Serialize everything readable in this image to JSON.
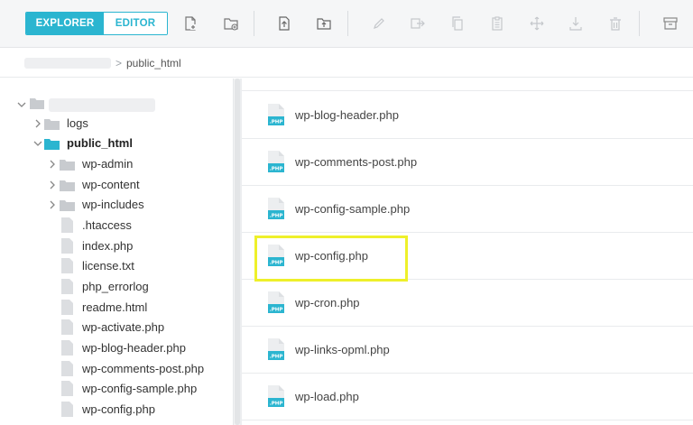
{
  "toolbar": {
    "explorer_label": "EXPLORER",
    "editor_label": "EDITOR",
    "accent_color": "#2bb5d0",
    "icons": [
      "new-file-icon",
      "new-folder-icon",
      "upload-file-icon",
      "upload-folder-icon",
      "rename-icon",
      "move-icon",
      "copy-icon",
      "paste-icon",
      "drag-move-icon",
      "download-icon",
      "delete-icon",
      "archive-icon"
    ]
  },
  "breadcrumb": {
    "separator": ">",
    "current": "public_html"
  },
  "tree": {
    "items": [
      {
        "label": "logs"
      },
      {
        "label": "public_html"
      },
      {
        "label": "wp-admin"
      },
      {
        "label": "wp-content"
      },
      {
        "label": "wp-includes"
      },
      {
        "label": ".htaccess"
      },
      {
        "label": "index.php"
      },
      {
        "label": "license.txt"
      },
      {
        "label": "php_errorlog"
      },
      {
        "label": "readme.html"
      },
      {
        "label": "wp-activate.php"
      },
      {
        "label": "wp-blog-header.php"
      },
      {
        "label": "wp-comments-post.php"
      },
      {
        "label": "wp-config-sample.php"
      },
      {
        "label": "wp-config.php"
      }
    ]
  },
  "files": {
    "badge": ".PHP",
    "items": [
      {
        "name": "wp-blog-header.php"
      },
      {
        "name": "wp-comments-post.php"
      },
      {
        "name": "wp-config-sample.php"
      },
      {
        "name": "wp-config.php"
      },
      {
        "name": "wp-cron.php"
      },
      {
        "name": "wp-links-opml.php"
      },
      {
        "name": "wp-load.php"
      }
    ],
    "highlight_color": "#eef02a"
  }
}
